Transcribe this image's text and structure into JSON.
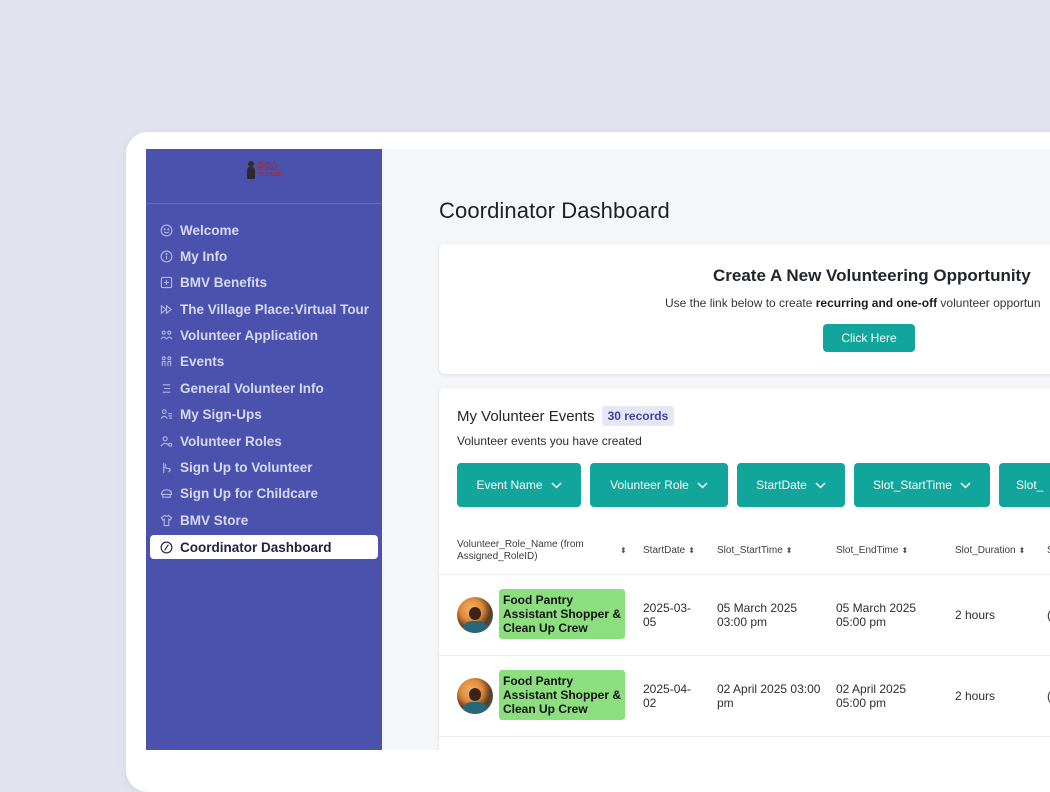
{
  "sidebar": {
    "logo": {
      "lines": [
        "BLACK",
        "MAMAS",
        "VILLAGE"
      ]
    },
    "items": [
      {
        "label": "Welcome",
        "icon": "smiley-icon"
      },
      {
        "label": "My Info",
        "icon": "info-icon"
      },
      {
        "label": "BMV Benefits",
        "icon": "plus-box-icon"
      },
      {
        "label": "The Village Place:Virtual Tour",
        "icon": "fast-forward-icon"
      },
      {
        "label": "Volunteer Application",
        "icon": "people-icon"
      },
      {
        "label": "Events",
        "icon": "group-icon"
      },
      {
        "label": "General Volunteer Info",
        "icon": "list-icon"
      },
      {
        "label": "My Sign-Ups",
        "icon": "person-list-icon"
      },
      {
        "label": "Volunteer Roles",
        "icon": "person-gear-icon"
      },
      {
        "label": "Sign Up to Volunteer",
        "icon": "hand-icon"
      },
      {
        "label": "Sign Up for Childcare",
        "icon": "stroller-icon"
      },
      {
        "label": "BMV Store",
        "icon": "shirt-icon"
      },
      {
        "label": "Coordinator Dashboard",
        "icon": "gauge-icon",
        "active": true
      }
    ]
  },
  "main": {
    "title": "Coordinator Dashboard",
    "create_card": {
      "title": "Create A New Volunteering Opportunity",
      "desc_prefix": "Use the link below to create ",
      "desc_bold": "recurring and one-off",
      "desc_suffix": " volunteer opportun",
      "button": "Click Here"
    },
    "events_card": {
      "title": "My Volunteer Events",
      "count": "30 records",
      "desc": "Volunteer events you have created",
      "filters": [
        "Event Name",
        "Volunteer Role",
        "StartDate",
        "Slot_StartTime",
        "Slot_"
      ]
    },
    "table": {
      "columns": [
        "Volunteer_Role_Name (from Assigned_RoleID)",
        "StartDate",
        "Slot_StartTime",
        "Slot_EndTime",
        "Slot_Duration",
        "S"
      ],
      "rows": [
        {
          "role": "Food Pantry Assistant Shopper & Clean Up Crew",
          "start_date": "2025-03-05",
          "slot_start": "05 March 2025 03:00 pm",
          "slot_end": "05 March 2025 05:00 pm",
          "duration": "2 hours",
          "extra": "("
        },
        {
          "role": "Food Pantry Assistant Shopper & Clean Up Crew",
          "start_date": "2025-04-02",
          "slot_start": "02 April 2025 03:00 pm",
          "slot_end": "02 April 2025 05:00 pm",
          "duration": "2 hours",
          "extra": "("
        }
      ]
    }
  },
  "colors": {
    "sidebar": "#4b52ad",
    "accent_teal": "#12a59b",
    "role_tag": "#8cde7f",
    "background": "#e1e3ee"
  }
}
